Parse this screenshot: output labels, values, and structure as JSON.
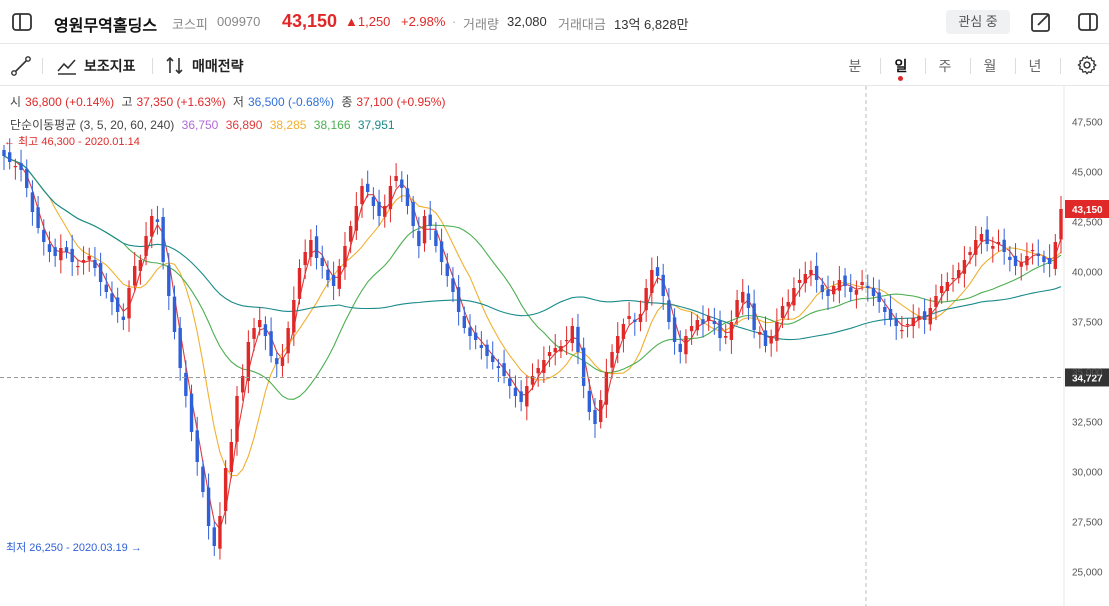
{
  "header": {
    "stock_name": "영원무역홀딩스",
    "market": "코스피",
    "code": "009970",
    "price": "43,150",
    "change": "▲1,250",
    "change_pct": "+2.98%",
    "volume_label": "거래량",
    "volume": "32,080",
    "amount_label": "거래대금",
    "amount": "13억 6,828만",
    "watch_label": "관심 중",
    "dot": "·"
  },
  "toolbar": {
    "indicator_label": "보조지표",
    "strategy_label": "매매전략",
    "periods": [
      "분",
      "일",
      "주",
      "월",
      "년"
    ],
    "active_period": "일"
  },
  "info": {
    "open_label": "시",
    "open": "36,800 (+0.14%)",
    "high_label": "고",
    "high": "37,350 (+1.63%)",
    "low_label": "저",
    "low": "36,500 (-0.68%)",
    "close_label": "종",
    "close": "37,100 (+0.95%)",
    "ma_label": "단순이동평균 (3, 5, 20, 60, 240)",
    "ma_values": [
      "36,750",
      "36,890",
      "38,285",
      "38,166",
      "37,951"
    ],
    "ma_colors": [
      "#b06ad8",
      "#e03a3a",
      "#f0b030",
      "#4caf50",
      "#1a8a8a"
    ]
  },
  "chart_data": {
    "type": "candlestick",
    "ylim": [
      24000,
      49000
    ],
    "y_ticks": [
      "25,000",
      "27,500",
      "30,000",
      "32,500",
      "35,000",
      "37,500",
      "40,000",
      "42,500",
      "45,000",
      "47,500"
    ],
    "y_tick_values": [
      25000,
      27500,
      30000,
      32500,
      35000,
      37500,
      40000,
      42500,
      45000,
      47500
    ],
    "last_price": 43150,
    "last_price_label": "43,150",
    "crosshair_price": 34727,
    "crosshair_label": "34,727",
    "max_annotation": "← 최고 46,300 - 2020.01.14",
    "min_annotation": "최저 26,250 - 2020.03.19 →",
    "max_value": 46300,
    "min_value": 26250,
    "up_color": "#e02828",
    "down_color": "#3060d8",
    "close_path": [
      45800,
      45500,
      45300,
      45100,
      44200,
      43000,
      42200,
      41500,
      41000,
      40800,
      41200,
      41000,
      40500,
      40300,
      40600,
      40800,
      40200,
      39500,
      39000,
      38500,
      38000,
      37600,
      39200,
      40300,
      40600,
      41800,
      42800,
      42500,
      40500,
      38800,
      37000,
      35200,
      33800,
      32000,
      30500,
      29000,
      27300,
      26300,
      27800,
      30200,
      31500,
      33800,
      34800,
      36500,
      37200,
      37600,
      36800,
      35800,
      35400,
      35700,
      37200,
      38600,
      40200,
      41000,
      41600,
      40700,
      40300,
      39600,
      39300,
      40300,
      41300,
      42300,
      43300,
      44300,
      44000,
      43300,
      42800,
      43300,
      44300,
      44800,
      44200,
      43300,
      42300,
      41300,
      42800,
      42300,
      41300,
      40500,
      39800,
      39000,
      38000,
      37200,
      36800,
      36600,
      36200,
      35800,
      35500,
      35200,
      34800,
      34300,
      33800,
      33500,
      34300,
      34800,
      35200,
      35600,
      36000,
      36200,
      36300,
      36600,
      37300,
      36000,
      34300,
      33000,
      32400,
      33600,
      35000,
      36000,
      36800,
      37400,
      37800,
      37500,
      37900,
      39200,
      40100,
      39800,
      38800,
      37500,
      36500,
      36000,
      36800,
      37300,
      37600,
      37400,
      37800,
      37400,
      36700,
      36800,
      37500,
      38600,
      39000,
      38200,
      37100,
      37000,
      36300,
      36800,
      37500,
      38300,
      38500,
      39200,
      39600,
      39900,
      40100,
      39600,
      39000,
      38800,
      39300,
      39600,
      39300,
      39000,
      39100,
      39500,
      39200,
      38800,
      38500,
      38000,
      37600,
      37300,
      37100,
      37400,
      37700,
      37800,
      37600,
      38200,
      38800,
      39300,
      39500,
      39700,
      40100,
      40600,
      41000,
      41600,
      41900,
      41400,
      41300,
      41500,
      41000,
      40600,
      40300,
      40500,
      40800,
      41100,
      40800,
      40500,
      40400,
      41500,
      43150
    ]
  }
}
